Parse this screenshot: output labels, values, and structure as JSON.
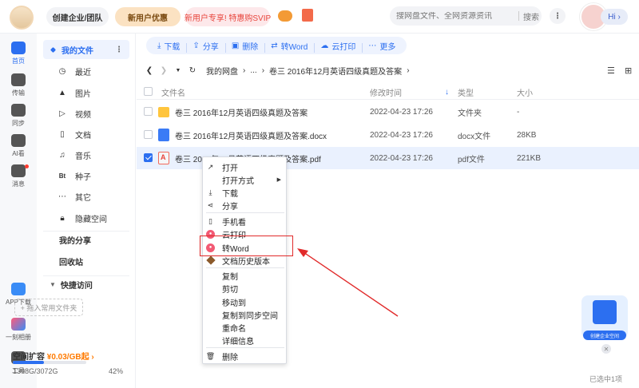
{
  "header": {
    "create_company_label": "创建企业/团队",
    "new_user_offer_label": "新用户优惠",
    "svip_promo_label": "新用户专享! 特惠购SVIP",
    "search_placeholder": "搜网盘文件、全网资源资讯",
    "search_button_label": "搜索",
    "greeting_label": "Hi"
  },
  "rail": {
    "items": [
      {
        "label": "首页",
        "icon": "home-icon"
      },
      {
        "label": "传输",
        "icon": "transfer-icon"
      },
      {
        "label": "同步",
        "icon": "sync-icon"
      },
      {
        "label": "AI看",
        "icon": "ai-icon"
      },
      {
        "label": "消息",
        "icon": "message-icon"
      },
      {
        "label": "APP下载",
        "icon": "app-icon"
      },
      {
        "label": "一刻相册",
        "icon": "album-icon"
      },
      {
        "label": "工具",
        "icon": "tools-icon"
      }
    ]
  },
  "sidebar": {
    "my_files_label": "我的文件",
    "categories": [
      {
        "label": "最近",
        "icon": "clock-icon"
      },
      {
        "label": "图片",
        "icon": "image-icon"
      },
      {
        "label": "视频",
        "icon": "video-icon"
      },
      {
        "label": "文档",
        "icon": "document-icon"
      },
      {
        "label": "音乐",
        "icon": "music-icon"
      },
      {
        "label": "种子",
        "icon": "torrent-icon"
      },
      {
        "label": "其它",
        "icon": "more-icon"
      },
      {
        "label": "隐藏空间",
        "icon": "lock-icon"
      }
    ],
    "my_share_label": "我的分享",
    "recycle_label": "回收站",
    "quick_access_label": "快捷访问",
    "drag_hint_label": "+ 拖入常用文件夹",
    "space_expand_label": "空间扩容",
    "space_price_label": "¥0.03/GB起",
    "space_usage_label": "1308G/3072G",
    "space_percent_label": "42%",
    "space_used_fraction": 0.42
  },
  "toolbar": {
    "download_label": "下载",
    "share_label": "分享",
    "delete_label": "删除",
    "to_word_label": "转Word",
    "cloud_print_label": "云打印",
    "more_label": "更多"
  },
  "breadcrumb": {
    "root_label": "我的网盘",
    "ellipsis_label": "...",
    "current_label": "卷三 2016年12月英语四级真题及答案"
  },
  "table": {
    "headers": {
      "name": "文件名",
      "modified": "修改时间",
      "type": "类型",
      "size": "大小"
    },
    "rows": [
      {
        "name": "卷三 2016年12月英语四级真题及答案",
        "modified": "2022-04-23 17:26",
        "type": "文件夹",
        "size": "-",
        "icon": "folder-icon",
        "selected": false
      },
      {
        "name": "卷三 2016年12月英语四级真题及答案.docx",
        "modified": "2022-04-23 17:26",
        "type": "docx文件",
        "size": "28KB",
        "icon": "word-file-icon",
        "selected": false
      },
      {
        "name": "卷三 2016年12月英语四级真题及答案.pdf",
        "modified": "2022-04-23 17:26",
        "type": "pdf文件",
        "size": "221KB",
        "icon": "pdf-file-icon",
        "selected": true
      }
    ]
  },
  "context_menu": {
    "items": [
      {
        "label": "打开",
        "icon": "open-icon"
      },
      {
        "label": "打开方式",
        "icon": "",
        "submenu": true
      },
      {
        "label": "下载",
        "icon": "download-icon"
      },
      {
        "label": "分享",
        "icon": "share-icon"
      },
      {
        "label": "手机看",
        "icon": "phone-icon"
      },
      {
        "label": "云打印",
        "icon": "cloud-print-icon"
      },
      {
        "label": "转Word",
        "icon": "to-word-icon"
      },
      {
        "label": "文档历史版本",
        "icon": "history-icon"
      },
      {
        "label": "复制",
        "icon": ""
      },
      {
        "label": "剪切",
        "icon": ""
      },
      {
        "label": "移动到",
        "icon": ""
      },
      {
        "label": "复制到同步空间",
        "icon": ""
      },
      {
        "label": "重命名",
        "icon": ""
      },
      {
        "label": "详细信息",
        "icon": ""
      },
      {
        "label": "删除",
        "icon": "trash-icon"
      }
    ]
  },
  "promo": {
    "label": "创建企业空间"
  },
  "status": {
    "selected_label": "已选中1项"
  },
  "colors": {
    "accent": "#2c6ff0",
    "highlight_box": "#e12a2a",
    "price": "#ff7a00"
  }
}
